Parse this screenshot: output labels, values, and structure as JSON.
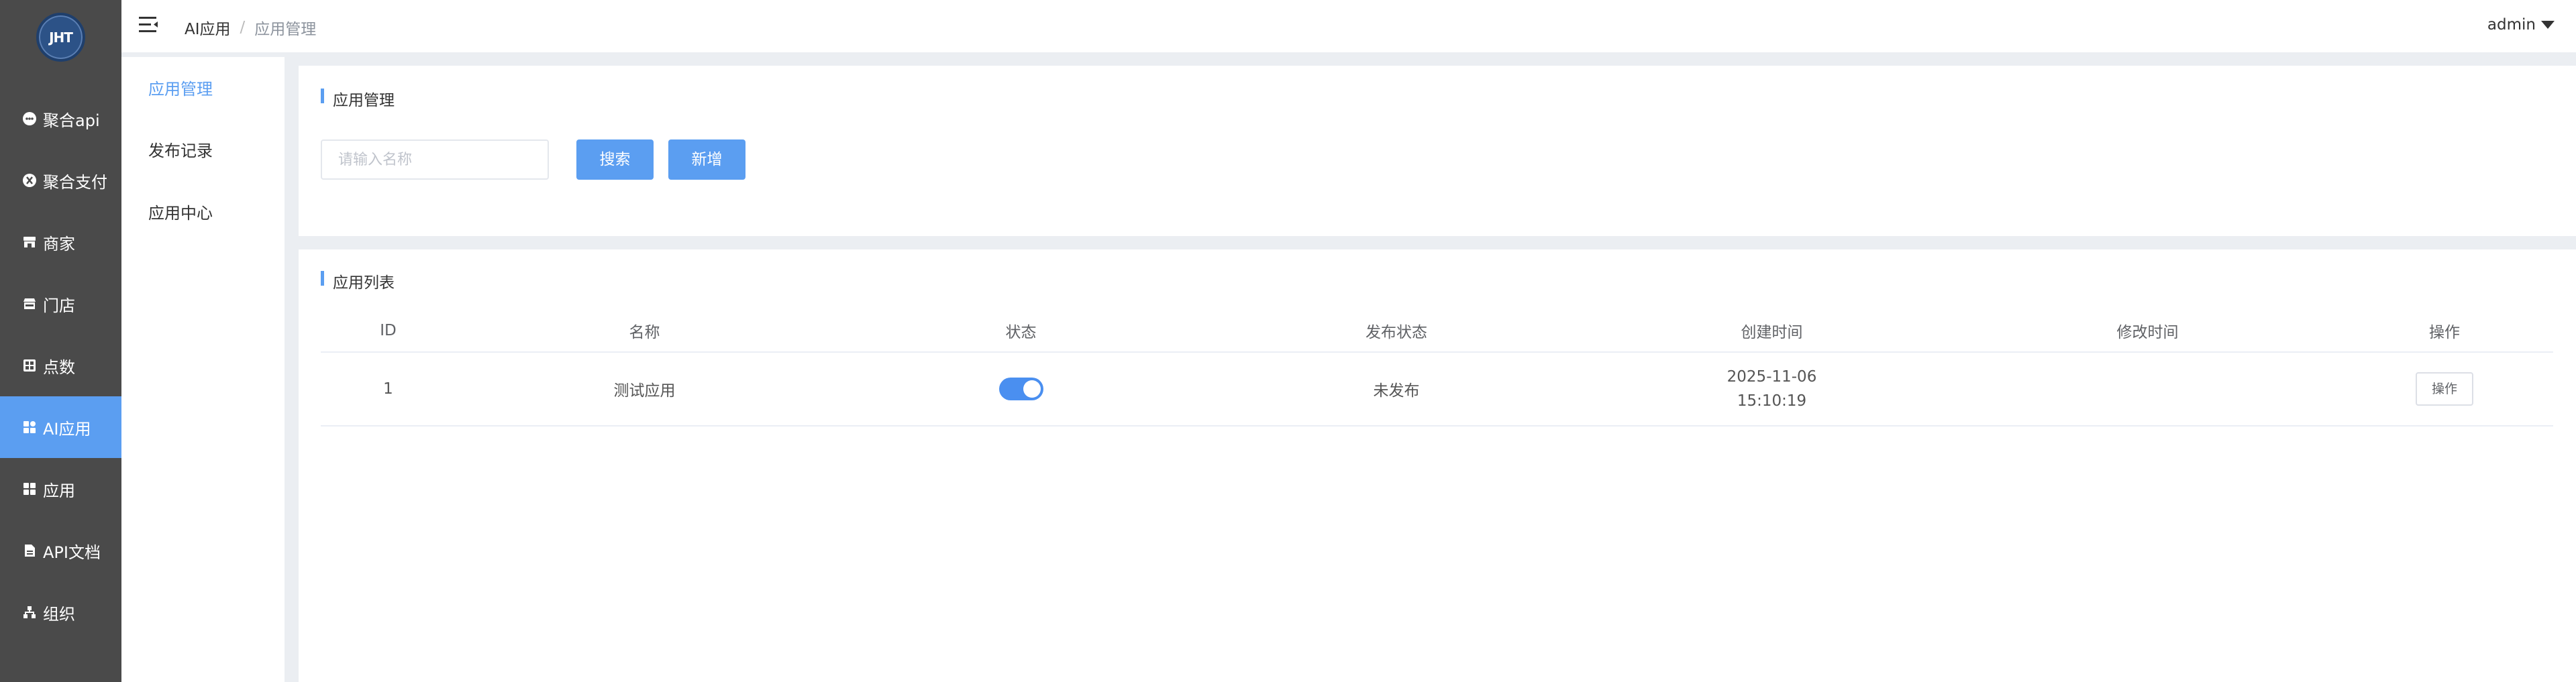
{
  "sidebar": {
    "logo_text": "JHT",
    "items": [
      {
        "label": "聚合api",
        "icon": "api-icon"
      },
      {
        "label": "聚合支付",
        "icon": "payment-icon"
      },
      {
        "label": "商家",
        "icon": "store-icon"
      },
      {
        "label": "门店",
        "icon": "shop-icon"
      },
      {
        "label": "点数",
        "icon": "points-icon"
      },
      {
        "label": "AI应用",
        "icon": "ai-app-icon",
        "active": true
      },
      {
        "label": "应用",
        "icon": "apps-icon"
      },
      {
        "label": "API文档",
        "icon": "document-icon"
      },
      {
        "label": "组织",
        "icon": "organization-icon"
      }
    ]
  },
  "header": {
    "breadcrumb": [
      "AI应用",
      "应用管理"
    ],
    "breadcrumb_sep": "/",
    "user": "admin"
  },
  "subnav": {
    "items": [
      {
        "label": "应用管理",
        "active": true
      },
      {
        "label": "发布记录"
      },
      {
        "label": "应用中心"
      }
    ]
  },
  "search_section": {
    "title": "应用管理",
    "search_placeholder": "请输入名称",
    "search_value": "",
    "search_button": "搜索",
    "add_button": "新增"
  },
  "list_section": {
    "title": "应用列表",
    "columns": [
      "ID",
      "名称",
      "状态",
      "发布状态",
      "创建时间",
      "修改时间",
      "操作"
    ],
    "rows": [
      {
        "id": "1",
        "name": "测试应用",
        "status_enabled": true,
        "publish_status": "未发布",
        "created_date": "2025-11-06",
        "created_time": "15:10:19",
        "modified": "",
        "action": "操作"
      }
    ]
  },
  "colors": {
    "sidebar_bg": "#4a4a4a",
    "accent": "#5b9ef1",
    "page_bg": "#ebeef2"
  }
}
